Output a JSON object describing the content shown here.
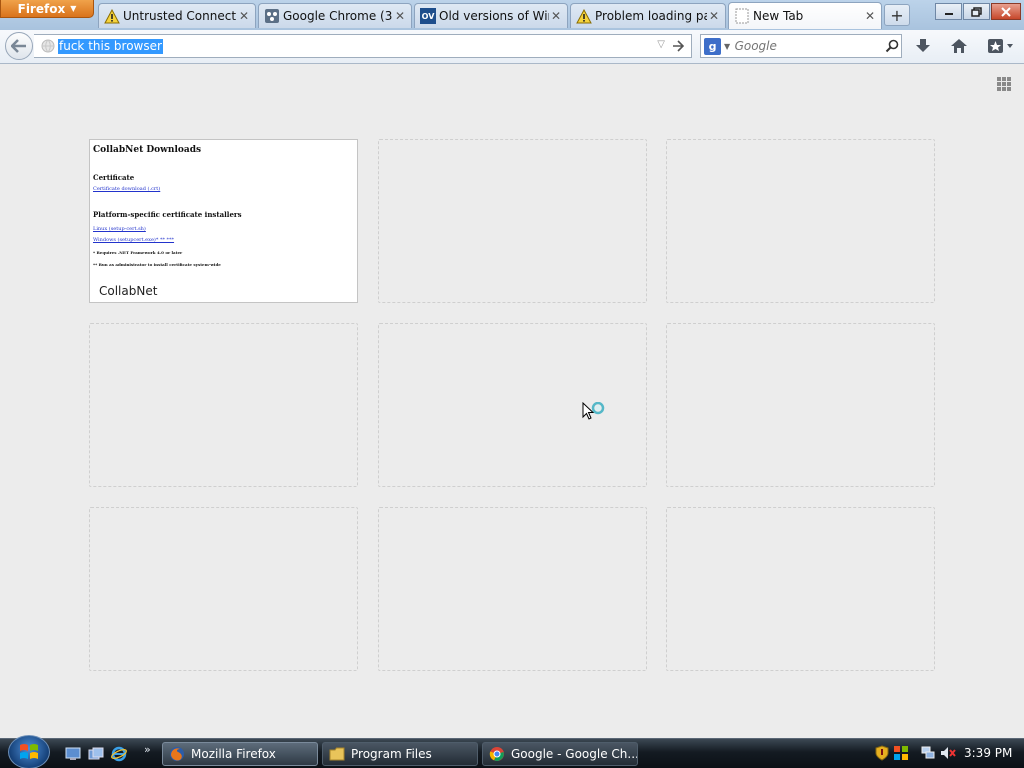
{
  "browser": {
    "menu_button": "Firefox",
    "tabs": [
      {
        "title": "Untrusted Connecti...",
        "icon": "warning-icon"
      },
      {
        "title": "Google Chrome (32...",
        "icon": "filehippo-icon"
      },
      {
        "title": "Old versions of Win...",
        "icon": "oldversion-icon",
        "icon_text": "OV"
      },
      {
        "title": "Problem loading pa...",
        "icon": "warning-icon"
      },
      {
        "title": "New Tab",
        "icon": "blank-page-icon"
      }
    ],
    "url": "fuck this browser",
    "search": {
      "engine": "Google",
      "placeholder": "Google",
      "engine_letter": "g"
    }
  },
  "new_tab_page": {
    "tiles": [
      {
        "caption": "CollabNet",
        "thumbnail": {
          "heading": "CollabNet Downloads",
          "section1": "Certificate",
          "link1": "Certificate download (.crt)",
          "section2": "Platform-specific certificate installers",
          "link2": "Linux (setup-cert.sh)",
          "link3": "Windows (setupcert.exe)* ** ***",
          "note1": "* Requires .NET Framework 4.0 or later",
          "note2": "** Run as administrator to install certificate system-wide"
        }
      },
      {
        "caption": ""
      },
      {
        "caption": ""
      },
      {
        "caption": ""
      },
      {
        "caption": ""
      },
      {
        "caption": ""
      },
      {
        "caption": ""
      },
      {
        "caption": ""
      },
      {
        "caption": ""
      }
    ]
  },
  "taskbar": {
    "tasks": [
      {
        "label": "Mozilla Firefox",
        "icon": "firefox-icon"
      },
      {
        "label": "Program Files",
        "icon": "folder-icon"
      },
      {
        "label": "Google - Google Ch...",
        "icon": "chrome-icon"
      }
    ],
    "clock": "3:39 PM"
  },
  "colors": {
    "firefox_button": "#e07b24",
    "url_selection": "#3399ff",
    "page_background": "#ececec",
    "taskbar": "#141b22"
  }
}
